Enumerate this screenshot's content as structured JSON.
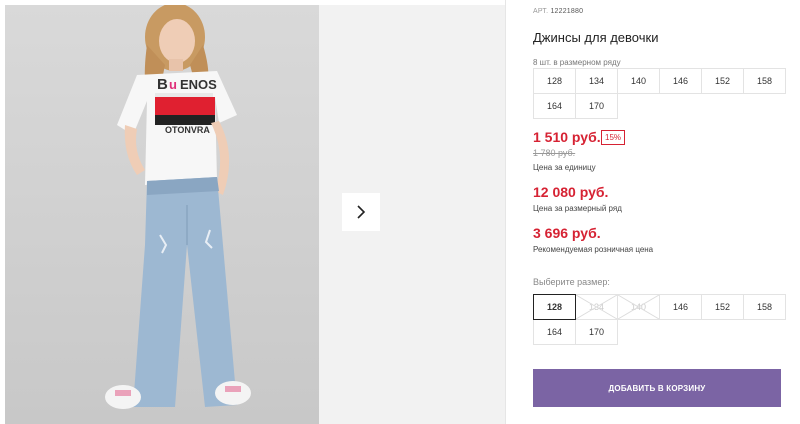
{
  "product": {
    "article_label": "АРТ.",
    "article_value": "12221880",
    "title": "Джинсы для девочки",
    "pack_label": "8 шт. в размерном ряду",
    "pack_sizes": [
      "128",
      "134",
      "140",
      "146",
      "152",
      "158",
      "164",
      "170"
    ]
  },
  "prices": {
    "unit_price": "1 510 руб.",
    "discount": "15%",
    "old_price": "1 780 руб.",
    "unit_caption": "Цена за единицу",
    "pack_price": "12 080 руб.",
    "pack_caption": "Цена за размерный ряд",
    "rrp_price": "3 696 руб.",
    "rrp_caption": "Рекомендуемая розничная цена"
  },
  "size_picker": {
    "label": "Выберите размер:",
    "sizes": [
      {
        "label": "128",
        "state": "selected"
      },
      {
        "label": "134",
        "state": "disabled"
      },
      {
        "label": "140",
        "state": "disabled"
      },
      {
        "label": "146",
        "state": "available"
      },
      {
        "label": "152",
        "state": "available"
      },
      {
        "label": "158",
        "state": "available"
      },
      {
        "label": "164",
        "state": "available"
      },
      {
        "label": "170",
        "state": "available"
      }
    ]
  },
  "actions": {
    "add_to_cart": "ДОБАВИТЬ В КОРЗИНУ"
  },
  "gallery": {
    "next_icon": "chevron-right-icon",
    "image_subject": "girl-in-jeans-photo"
  },
  "colors": {
    "price_red": "#d62233",
    "cart_purple": "#7b64a4"
  }
}
